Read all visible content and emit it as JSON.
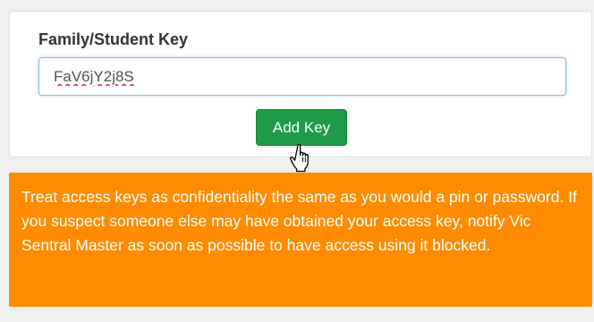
{
  "form": {
    "label": "Family/Student Key",
    "key_value": "FaV6jY2j8S",
    "button_label": "Add Key"
  },
  "notice": {
    "text": "Treat access keys as confidentiality the same as you would a pin or password. If you suspect someone else may have obtained your access key, notify Vic Sentral Master as soon as possible to have access using it blocked."
  },
  "colors": {
    "button_green": "#1e9b47",
    "notice_orange": "#ff8c00",
    "input_focus_border": "#8db8e0"
  },
  "icons": {
    "cursor": "hand-pointer-icon"
  }
}
